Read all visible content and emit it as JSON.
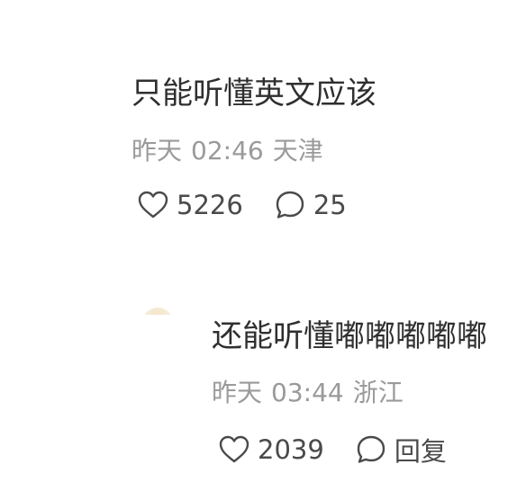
{
  "comments": [
    {
      "text": "只能听懂英文应该",
      "date": "昨天",
      "time": "02:46",
      "location": "天津",
      "likes": "5226",
      "replies": "25"
    },
    {
      "text": "还能听懂嘟嘟嘟嘟嘟",
      "date": "昨天",
      "time": "03:44",
      "location": "浙江",
      "likes": "2039",
      "reply_label": "回复"
    }
  ],
  "icons": {
    "like": "heart-outline-icon",
    "comment": "speech-bubble-outline-icon"
  },
  "colors": {
    "text": "#2f2f2f",
    "meta": "#9a9a9a",
    "icon": "#4a4a4a"
  }
}
